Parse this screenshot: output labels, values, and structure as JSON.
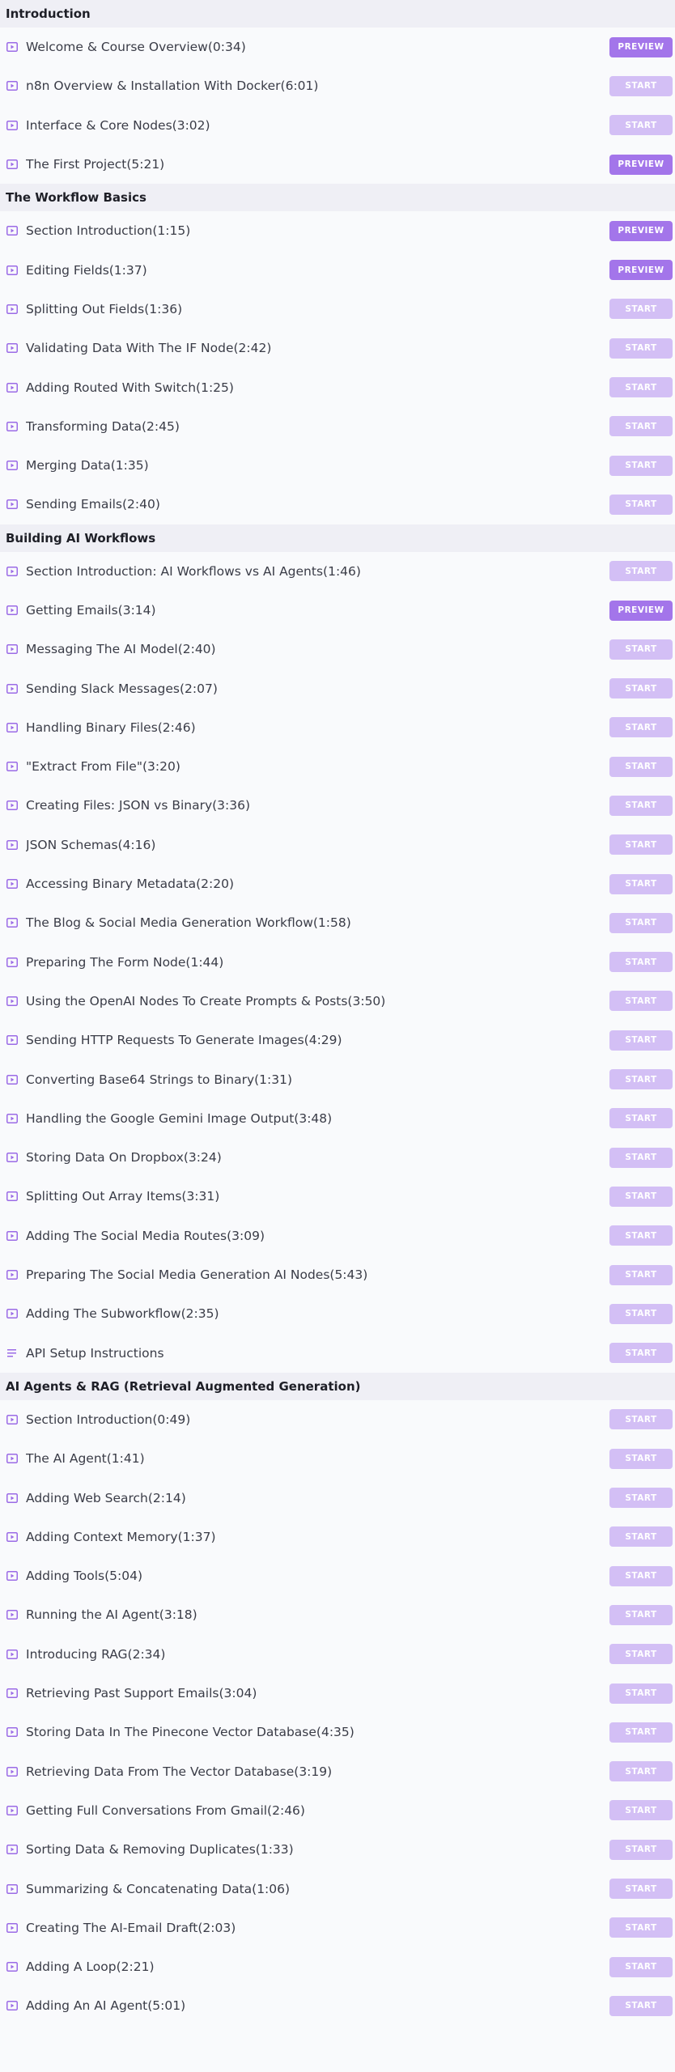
{
  "colors": {
    "section_bg": "#efeff5",
    "row_bg": "#f9fafc",
    "start_button": "#d3bff5",
    "preview_button": "#a375ea",
    "icon": "#9b6be6"
  },
  "sections": [
    {
      "title": "Introduction",
      "lectures": [
        {
          "label": "Welcome & Course Overview(0:34)",
          "icon": "video-icon",
          "button": "PREVIEW",
          "type": "preview"
        },
        {
          "label": "n8n Overview & Installation With Docker(6:01)",
          "icon": "video-icon",
          "button": "START",
          "type": "start"
        },
        {
          "label": "Interface & Core Nodes(3:02)",
          "icon": "video-icon",
          "button": "START",
          "type": "start"
        },
        {
          "label": "The First Project(5:21)",
          "icon": "video-icon",
          "button": "PREVIEW",
          "type": "preview"
        }
      ]
    },
    {
      "title": "The Workflow Basics",
      "lectures": [
        {
          "label": "Section Introduction(1:15)",
          "icon": "video-icon",
          "button": "PREVIEW",
          "type": "preview"
        },
        {
          "label": "Editing Fields(1:37)",
          "icon": "video-icon",
          "button": "PREVIEW",
          "type": "preview"
        },
        {
          "label": "Splitting Out Fields(1:36)",
          "icon": "video-icon",
          "button": "START",
          "type": "start"
        },
        {
          "label": "Validating Data With The IF Node(2:42)",
          "icon": "video-icon",
          "button": "START",
          "type": "start"
        },
        {
          "label": "Adding Routed With Switch(1:25)",
          "icon": "video-icon",
          "button": "START",
          "type": "start"
        },
        {
          "label": "Transforming Data(2:45)",
          "icon": "video-icon",
          "button": "START",
          "type": "start"
        },
        {
          "label": "Merging Data(1:35)",
          "icon": "video-icon",
          "button": "START",
          "type": "start"
        },
        {
          "label": "Sending Emails(2:40)",
          "icon": "video-icon",
          "button": "START",
          "type": "start"
        }
      ]
    },
    {
      "title": "Building AI Workflows",
      "lectures": [
        {
          "label": "Section Introduction: AI Workflows vs AI Agents(1:46)",
          "icon": "video-icon",
          "button": "START",
          "type": "start"
        },
        {
          "label": "Getting Emails(3:14)",
          "icon": "video-icon",
          "button": "PREVIEW",
          "type": "preview"
        },
        {
          "label": "Messaging The AI Model(2:40)",
          "icon": "video-icon",
          "button": "START",
          "type": "start"
        },
        {
          "label": "Sending Slack Messages(2:07)",
          "icon": "video-icon",
          "button": "START",
          "type": "start"
        },
        {
          "label": "Handling Binary Files(2:46)",
          "icon": "video-icon",
          "button": "START",
          "type": "start"
        },
        {
          "label": "\"Extract From File\"(3:20)",
          "icon": "video-icon",
          "button": "START",
          "type": "start"
        },
        {
          "label": "Creating Files: JSON vs Binary(3:36)",
          "icon": "video-icon",
          "button": "START",
          "type": "start"
        },
        {
          "label": "JSON Schemas(4:16)",
          "icon": "video-icon",
          "button": "START",
          "type": "start"
        },
        {
          "label": "Accessing Binary Metadata(2:20)",
          "icon": "video-icon",
          "button": "START",
          "type": "start"
        },
        {
          "label": "The Blog & Social Media Generation Workflow(1:58)",
          "icon": "video-icon",
          "button": "START",
          "type": "start"
        },
        {
          "label": "Preparing The Form Node(1:44)",
          "icon": "video-icon",
          "button": "START",
          "type": "start"
        },
        {
          "label": "Using the OpenAI Nodes To Create Prompts & Posts(3:50)",
          "icon": "video-icon",
          "button": "START",
          "type": "start"
        },
        {
          "label": "Sending HTTP Requests To Generate Images(4:29)",
          "icon": "video-icon",
          "button": "START",
          "type": "start"
        },
        {
          "label": "Converting Base64 Strings to Binary(1:31)",
          "icon": "video-icon",
          "button": "START",
          "type": "start"
        },
        {
          "label": "Handling the Google Gemini Image Output(3:48)",
          "icon": "video-icon",
          "button": "START",
          "type": "start"
        },
        {
          "label": "Storing Data On Dropbox(3:24)",
          "icon": "video-icon",
          "button": "START",
          "type": "start"
        },
        {
          "label": "Splitting Out Array Items(3:31)",
          "icon": "video-icon",
          "button": "START",
          "type": "start"
        },
        {
          "label": "Adding The Social Media Routes(3:09)",
          "icon": "video-icon",
          "button": "START",
          "type": "start"
        },
        {
          "label": "Preparing The Social Media Generation AI Nodes(5:43)",
          "icon": "video-icon",
          "button": "START",
          "type": "start"
        },
        {
          "label": "Adding The Subworkflow(2:35)",
          "icon": "video-icon",
          "button": "START",
          "type": "start"
        },
        {
          "label": "API Setup Instructions",
          "icon": "text-icon",
          "button": "START",
          "type": "start"
        }
      ]
    },
    {
      "title": "AI Agents & RAG (Retrieval Augmented Generation)",
      "lectures": [
        {
          "label": "Section Introduction(0:49)",
          "icon": "video-icon",
          "button": "START",
          "type": "start"
        },
        {
          "label": "The AI Agent(1:41)",
          "icon": "video-icon",
          "button": "START",
          "type": "start"
        },
        {
          "label": "Adding Web Search(2:14)",
          "icon": "video-icon",
          "button": "START",
          "type": "start"
        },
        {
          "label": "Adding Context Memory(1:37)",
          "icon": "video-icon",
          "button": "START",
          "type": "start"
        },
        {
          "label": "Adding Tools(5:04)",
          "icon": "video-icon",
          "button": "START",
          "type": "start"
        },
        {
          "label": "Running the AI Agent(3:18)",
          "icon": "video-icon",
          "button": "START",
          "type": "start"
        },
        {
          "label": "Introducing RAG(2:34)",
          "icon": "video-icon",
          "button": "START",
          "type": "start"
        },
        {
          "label": "Retrieving Past Support Emails(3:04)",
          "icon": "video-icon",
          "button": "START",
          "type": "start"
        },
        {
          "label": "Storing Data In The Pinecone Vector Database(4:35)",
          "icon": "video-icon",
          "button": "START",
          "type": "start"
        },
        {
          "label": "Retrieving Data From The Vector Database(3:19)",
          "icon": "video-icon",
          "button": "START",
          "type": "start"
        },
        {
          "label": "Getting Full Conversations From Gmail(2:46)",
          "icon": "video-icon",
          "button": "START",
          "type": "start"
        },
        {
          "label": "Sorting Data & Removing Duplicates(1:33)",
          "icon": "video-icon",
          "button": "START",
          "type": "start"
        },
        {
          "label": "Summarizing & Concatenating Data(1:06)",
          "icon": "video-icon",
          "button": "START",
          "type": "start"
        },
        {
          "label": "Creating The AI-Email Draft(2:03)",
          "icon": "video-icon",
          "button": "START",
          "type": "start"
        },
        {
          "label": "Adding A Loop(2:21)",
          "icon": "video-icon",
          "button": "START",
          "type": "start"
        },
        {
          "label": "Adding An AI Agent(5:01)",
          "icon": "video-icon",
          "button": "START",
          "type": "start"
        }
      ]
    }
  ]
}
